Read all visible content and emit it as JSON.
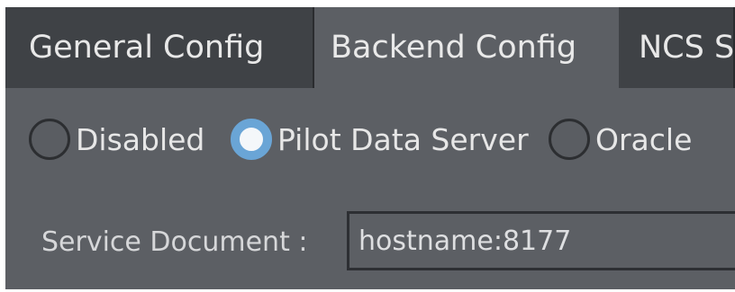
{
  "tabs": {
    "general": "General Config",
    "backend": "Backend Config",
    "ncs": "NCS Settings"
  },
  "active_tab": "backend",
  "backend": {
    "options": {
      "disabled": "Disabled",
      "pilot": "Pilot Data Server",
      "oracle": "Oracle"
    },
    "selected": "pilot",
    "service_document_label": "Service Document :",
    "service_document_value": "hostname:8177"
  },
  "colors": {
    "panel": "#5c5f64",
    "tab_inactive": "#3f4246",
    "radio_selected": "#6aa5d6",
    "text": "#e7e7e7"
  }
}
